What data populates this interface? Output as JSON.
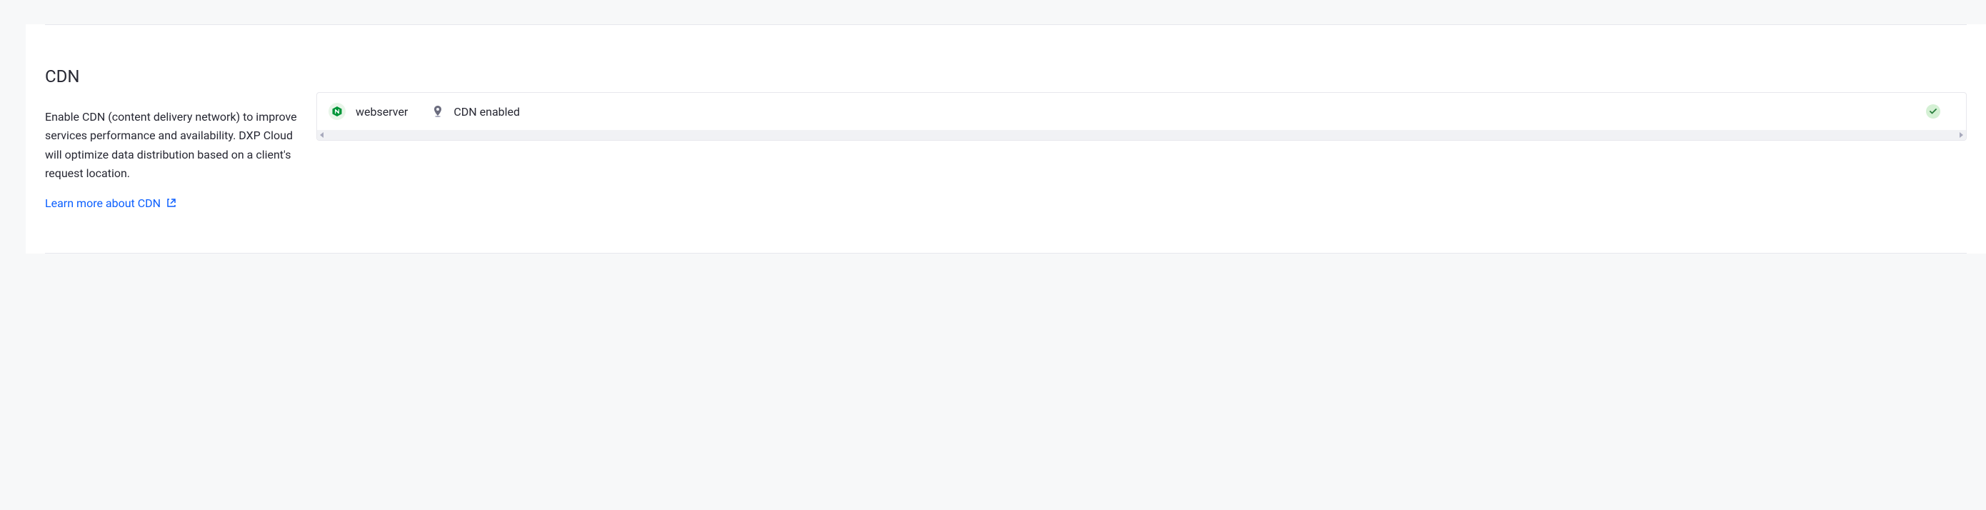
{
  "cdn": {
    "title": "CDN",
    "description": "Enable CDN (content delivery network) to improve services performance and availability. DXP Cloud will optimize data distribution based on a client's request location.",
    "learn_more_label": "Learn more about CDN",
    "service": {
      "name": "webserver",
      "status_text": "CDN enabled"
    }
  }
}
